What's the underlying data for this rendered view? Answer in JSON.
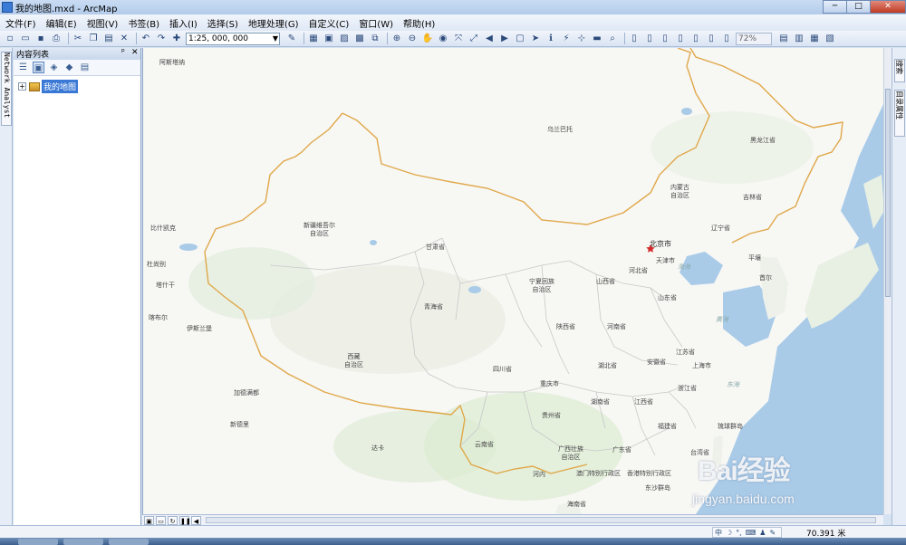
{
  "window": {
    "title": "我的地图.mxd - ArcMap",
    "minimize_glyph": "─",
    "maximize_glyph": "□",
    "close_glyph": "✕"
  },
  "menu": [
    "文件(F)",
    "编辑(E)",
    "视图(V)",
    "书签(B)",
    "插入(I)",
    "选择(S)",
    "地理处理(G)",
    "自定义(C)",
    "窗口(W)",
    "帮助(H)"
  ],
  "toolbar": {
    "scale": "1:25, 000, 000",
    "zoom_percent": "72%",
    "icons": [
      "new-icon",
      "open-icon",
      "save-icon",
      "print-icon",
      "cut-icon",
      "copy-icon",
      "paste-icon",
      "delete-icon",
      "undo-icon",
      "redo-icon",
      "add-data-icon",
      "zoom-in-icon",
      "zoom-out-icon",
      "pan-icon",
      "full-extent-icon",
      "back-icon",
      "forward-icon",
      "select-icon",
      "identify-icon",
      "find-icon"
    ]
  },
  "toc": {
    "title": "内容列表",
    "pin_glyph": "ᵖ",
    "close_glyph": "✕",
    "expander_glyph": "+",
    "map_name": "我的地图"
  },
  "left_dock": {
    "tab_label": "Network Analyst"
  },
  "right_dock": {
    "tabs": [
      "搜索",
      "目录属性"
    ]
  },
  "map": {
    "labels": {
      "beijing": "北京市",
      "tianjin": "天津市",
      "heilongjiang": "黑龙江省",
      "jilin": "吉林省",
      "liaoning": "辽宁省",
      "neimenggu": "内蒙古\n自治区",
      "xinjiang": "新疆维吾尔\n自治区",
      "gansu": "甘肃省",
      "qinghai": "青海省",
      "xizang": "西藏\n自治区",
      "ningxia": "宁夏回族\n自治区",
      "shanxi": "山西省",
      "hebei": "河北省",
      "shandong": "山东省",
      "shaanxi": "陕西省",
      "henan": "河南省",
      "jiangsu": "江苏省",
      "anhui": "安徽省",
      "shanghai": "上海市",
      "hubei": "湖北省",
      "sichuan": "四川省",
      "chongqing": "重庆市",
      "zhejiang": "浙江省",
      "hunan": "湖南省",
      "jiangxi": "江西省",
      "guizhou": "贵州省",
      "fujian": "福建省",
      "yunnan": "云南省",
      "guangxi": "广西壮族\n自治区",
      "guangdong": "广东省",
      "taiwan": "台湾省",
      "hainan": "海南省",
      "macau": "澳门特别行政区",
      "hongkong": "香港特别行政区",
      "ulanbator": "乌兰巴托",
      "bishkek": "比什凯克",
      "dushanbe": "杜尚别",
      "kabul": "喀布尔",
      "islamabad": "伊斯兰堡",
      "kathmandu": "加德满都",
      "dhaka": "达卡",
      "hanoi": "河内",
      "pyongyang": "平壤",
      "seoul": "首尔",
      "bohai": "渤海",
      "huanghai": "黄海",
      "donghai": "东海",
      "ryukyu": "琉球群岛",
      "dongsha": "东沙群岛",
      "astana": "阿斯塔纳",
      "tashkent": "塔什干",
      "newdelhi": "新德里"
    },
    "colors": {
      "land": "#f7f7f4",
      "water": "#a9cbe8",
      "border": "#e0a84a",
      "terrain": "#cfe3c6"
    }
  },
  "statusbar": {
    "coords": "70.391 米",
    "ime_items": [
      "中",
      "☽",
      "°,",
      "⌨",
      "♟",
      "✎"
    ]
  },
  "watermark": {
    "brand": "Bai经验",
    "url": "jingyan.baidu.com"
  }
}
